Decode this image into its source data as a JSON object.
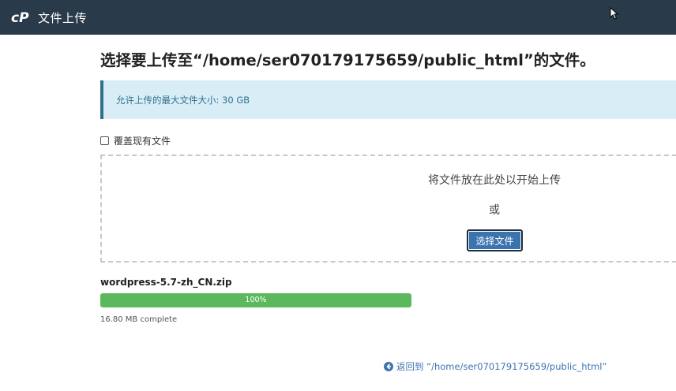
{
  "header": {
    "logo_icon": "cpanel-logo-icon",
    "title": "文件上传"
  },
  "main": {
    "title": "选择要上传至“/home/ser070179175659/public_html”的文件。",
    "max_size_info": "允许上传的最大文件大小: 30 GB",
    "overwrite_label": "覆盖现有文件",
    "overwrite_checked": false,
    "drop_text": "将文件放在此处以开始上传",
    "or_text": "或",
    "select_button": "选择文件"
  },
  "upload": {
    "filename": "wordpress-5.7-zh_CN.zip",
    "progress_percent": 100,
    "progress_label": "100%",
    "status": "16.80 MB complete"
  },
  "footer": {
    "back_icon": "arrow-left-circle-icon",
    "back_link": "返回到 “/home/ser070179175659/public_html”"
  },
  "colors": {
    "topbar": "#293a4a",
    "info_bg": "#d9edf7",
    "info_border": "#31708f",
    "button": "#3b73af",
    "progress": "#5cb85c",
    "link": "#3b73af"
  }
}
